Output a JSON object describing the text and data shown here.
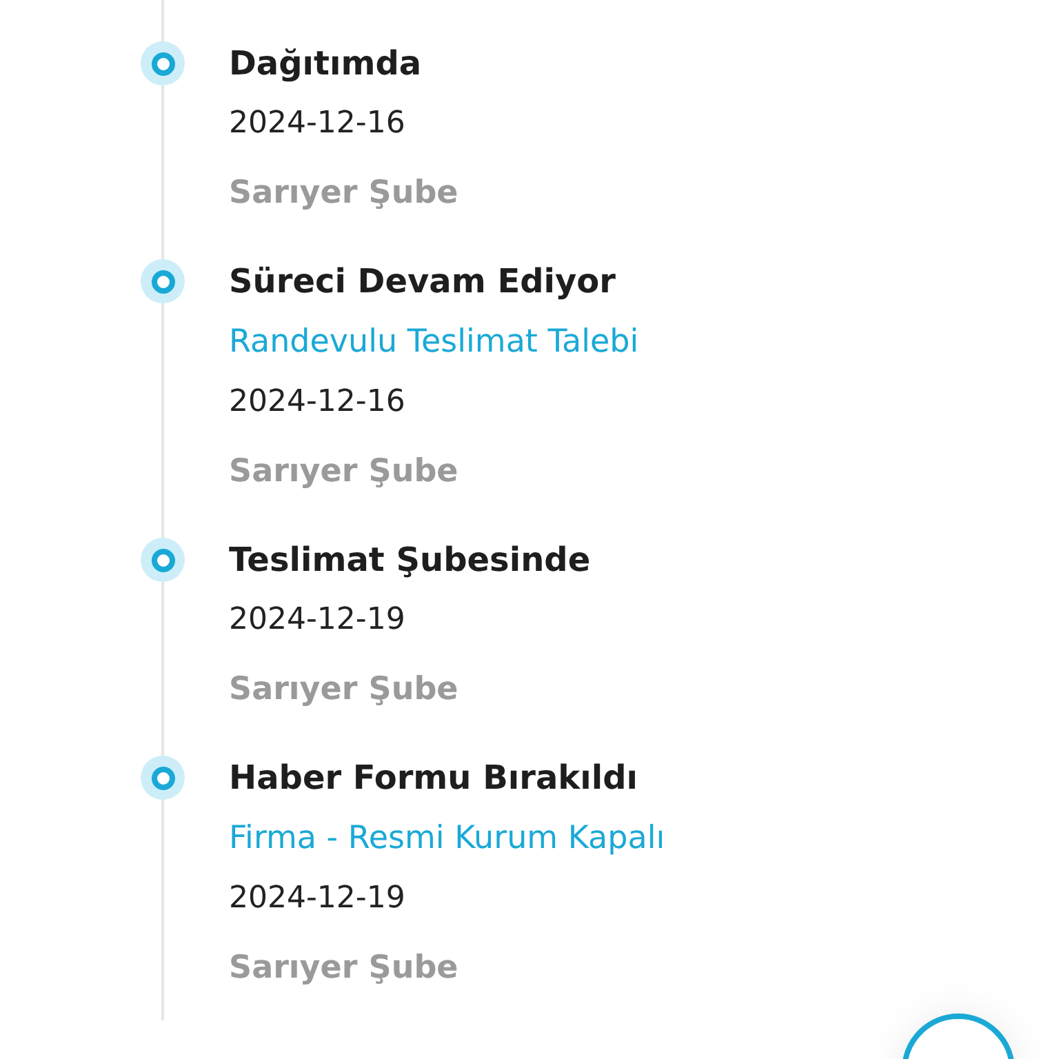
{
  "events": [
    {
      "title": "Dağıtımda",
      "date": "2024-12-16",
      "branch": "Sarıyer Şube"
    },
    {
      "title": "Süreci Devam Ediyor",
      "detail": "Randevulu Teslimat Talebi",
      "date": "2024-12-16",
      "branch": "Sarıyer Şube"
    },
    {
      "title": "Teslimat Şubesinde",
      "date": "2024-12-19",
      "branch": "Sarıyer Şube"
    },
    {
      "title": "Haber Formu Bırakıldı",
      "detail": "Firma - Resmi Kurum Kapalı",
      "date": "2024-12-19",
      "branch": "Sarıyer Şube"
    }
  ]
}
